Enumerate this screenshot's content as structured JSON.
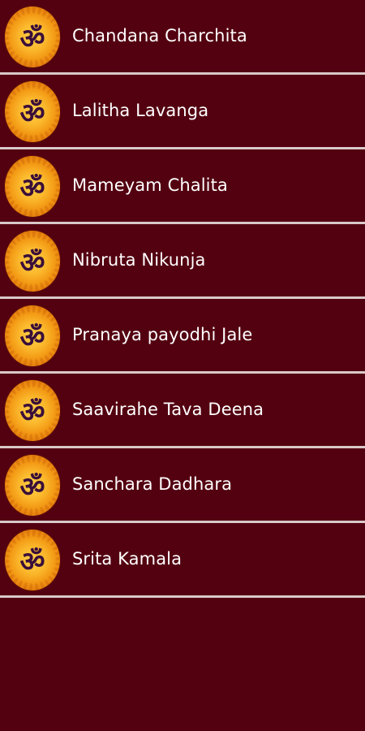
{
  "list": {
    "items": [
      {
        "label": "Chandana Charchita",
        "icon": "om-icon"
      },
      {
        "label": "Lalitha Lavanga",
        "icon": "om-icon"
      },
      {
        "label": "Mameyam Chalita",
        "icon": "om-icon"
      },
      {
        "label": "Nibruta Nikunja",
        "icon": "om-icon"
      },
      {
        "label": "Pranaya payodhi Jale",
        "icon": "om-icon"
      },
      {
        "label": "Saavirahe Tava Deena",
        "icon": "om-icon"
      },
      {
        "label": "Sanchara Dadhara",
        "icon": "om-icon"
      },
      {
        "label": "Srita Kamala",
        "icon": "om-icon"
      }
    ]
  },
  "colors": {
    "background": "#530010",
    "divider": "#d9c8c8",
    "text": "#ffffff",
    "badge": "#f39a15",
    "om_glyph": "#3a0f3a"
  }
}
